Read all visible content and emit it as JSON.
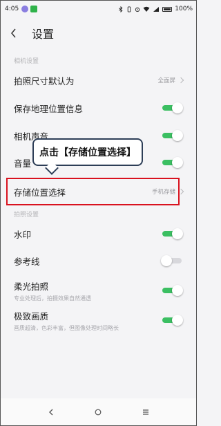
{
  "statusbar": {
    "time": "4:05",
    "battery": "100%",
    "battery_level": 1.0
  },
  "header": {
    "title": "设置"
  },
  "sections": {
    "camera": "相机设置",
    "photo": "拍照设置"
  },
  "rows": {
    "photo_size": {
      "label": "拍照尺寸默认为",
      "value": "全面屏"
    },
    "save_location_info": {
      "label": "保存地理位置信息",
      "on": true
    },
    "camera_sound": {
      "label": "相机声音",
      "on": true
    },
    "volume_key": {
      "label": "音量",
      "on": true
    },
    "storage_location": {
      "label": "存储位置选择",
      "value": "手机存储"
    },
    "watermark": {
      "label": "水印",
      "on": true
    },
    "gridlines": {
      "label": "参考线",
      "on": false
    },
    "soft_light": {
      "label": "柔光拍照",
      "sub": "专业处理后，拍摄效果自然通透",
      "on": true
    },
    "ultra_quality": {
      "label": "极致画质",
      "sub": "画质超清，色彩丰富，但图像处理时间略长",
      "on": true
    }
  },
  "callout": {
    "text": "点击【存储位置选择】"
  },
  "colors": {
    "accent": "#3bbf62",
    "highlight": "#d9121f",
    "callout_border": "#2d3e57"
  }
}
